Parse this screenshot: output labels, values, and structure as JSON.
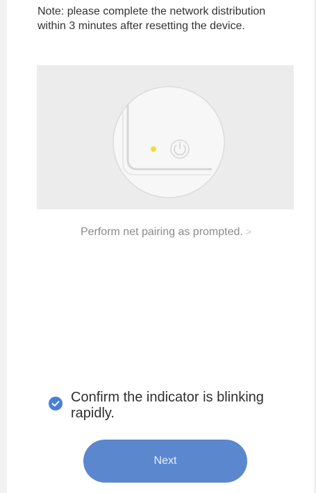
{
  "instructions": {
    "note": "Note: please complete the network distribution within 3 minutes after resetting the device."
  },
  "illustration": {
    "indicator_color": "#f2df2c",
    "icons": [
      "power-icon",
      "indicator-light"
    ]
  },
  "pairing_link": {
    "label": "Perform net pairing as prompted.",
    "chevron": ">"
  },
  "confirmation": {
    "label": "Confirm the indicator is blinking rapidly.",
    "checked": true,
    "check_color": "#4a7fd4"
  },
  "next_button": {
    "label": "Next",
    "color": "#5b87cf"
  }
}
